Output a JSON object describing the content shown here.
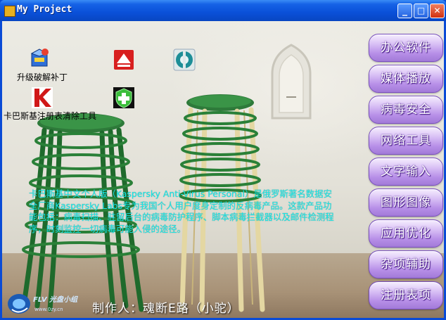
{
  "window": {
    "title": "My Project",
    "controls": {
      "minimize": "_",
      "maximize": "□",
      "close": "✕"
    }
  },
  "desktop_icons": [
    {
      "label": "升级破解补丁",
      "icon": "patch-box-icon"
    },
    {
      "label": "",
      "icon": "red-eject-icon"
    },
    {
      "label": "",
      "icon": "teal-disk-icon"
    },
    {
      "label": "卡巴斯基注册表清除工具",
      "icon": "kaspersky-k-icon"
    },
    {
      "label": "",
      "icon": "green-shield-plus-icon"
    }
  ],
  "description": "卡巴斯基中文个人版（Kaspersky Anti-Virus Personal）是俄罗斯著名数据安全厂商Kaspersky Labs专为我国个人用户度身定制的反病毒产品。这款产品功能包括：病毒扫描、驻留后台的病毒防护程序、脚本病毒拦截器以及邮件检测程序，时刻监控一切病毒可能入侵的途径。",
  "author_line": "制作人：魂断E路（小驼）",
  "logo": {
    "text": "FLV 光盘小组",
    "url_text": "www.0zy.cn"
  },
  "menu": [
    "办公软件",
    "媒体播放",
    "病毒安全",
    "网络工具",
    "文字输入",
    "图形图像",
    "应用优化",
    "杂项辅助",
    "注册表项"
  ],
  "colors": {
    "title_bar": "#0a50d8",
    "description_text": "#16e8e8",
    "menu_button": "#b890e8"
  }
}
